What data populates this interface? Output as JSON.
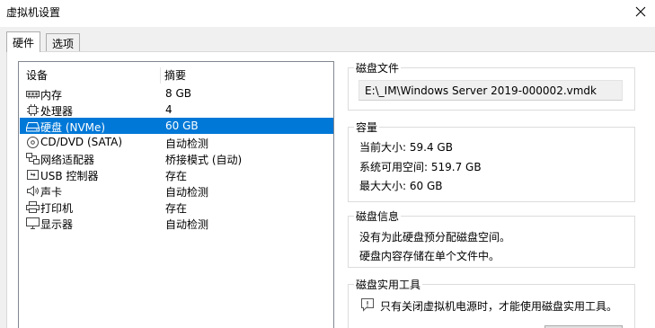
{
  "window": {
    "title": "虚拟机设置"
  },
  "tabs": [
    {
      "label": "硬件",
      "active": true
    },
    {
      "label": "选项",
      "active": false
    }
  ],
  "device_list": {
    "headers": {
      "device": "设备",
      "summary": "摘要"
    },
    "rows": [
      {
        "icon": "memory-icon",
        "name": "内存",
        "summary": "8 GB",
        "selected": false
      },
      {
        "icon": "processor-icon",
        "name": "处理器",
        "summary": "4",
        "selected": false
      },
      {
        "icon": "hard-disk-icon",
        "name": "硬盘 (NVMe)",
        "summary": "60 GB",
        "selected": true
      },
      {
        "icon": "cd-dvd-icon",
        "name": "CD/DVD (SATA)",
        "summary": "自动检测",
        "selected": false
      },
      {
        "icon": "network-adapter-icon",
        "name": "网络适配器",
        "summary": "桥接模式 (自动)",
        "selected": false
      },
      {
        "icon": "usb-icon",
        "name": "USB 控制器",
        "summary": "存在",
        "selected": false
      },
      {
        "icon": "sound-card-icon",
        "name": "声卡",
        "summary": "自动检测",
        "selected": false
      },
      {
        "icon": "printer-icon",
        "name": "打印机",
        "summary": "存在",
        "selected": false
      },
      {
        "icon": "display-icon",
        "name": "显示器",
        "summary": "自动检测",
        "selected": false
      }
    ]
  },
  "disk_file": {
    "title": "磁盘文件",
    "path": "E:\\_IM\\Windows Server 2019-000002.vmdk"
  },
  "capacity": {
    "title": "容量",
    "current_size": "当前大小: 59.4 GB",
    "available_space": "系统可用空间: 519.7 GB",
    "max_size": "最大大小: 60 GB"
  },
  "disk_info": {
    "title": "磁盘信息",
    "line1": "没有为此硬盘预分配磁盘空间。",
    "line2": "硬盘内容存储在单个文件中。"
  },
  "disk_utilities": {
    "title": "磁盘实用工具",
    "note": "只有关闭虚拟机电源时，才能使用磁盘实用工具。"
  },
  "colors": {
    "selection": "#0078d7",
    "background": "#f0f0f0"
  }
}
